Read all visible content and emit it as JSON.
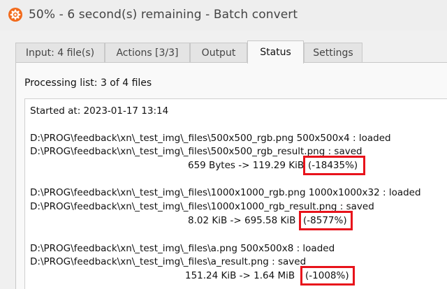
{
  "window": {
    "title": "50% - 6 second(s) remaining - Batch convert",
    "icon": "xnconvert-logo-icon"
  },
  "tabs": [
    {
      "label": "Input: 4 file(s)"
    },
    {
      "label": "Actions [3/3]"
    },
    {
      "label": "Output"
    },
    {
      "label": "Status",
      "active": true
    },
    {
      "label": "Settings"
    }
  ],
  "status": {
    "processing_label": "Processing list:  3 of 4 files",
    "started": "Started at: 2023-01-17 13:14",
    "entries": [
      {
        "loaded": "D:\\PROG\\feedback\\xn\\_test_img\\_files\\500x500_rgb.png 500x500x4 : loaded",
        "saved": "D:\\PROG\\feedback\\xn\\_test_img\\_files\\500x500_rgb_result.png : saved",
        "size": "659 Bytes -> 119.29 KiB",
        "percent": "(-18435%)"
      },
      {
        "loaded": "D:\\PROG\\feedback\\xn\\_test_img\\_files\\1000x1000_rgb.png 1000x1000x32 : loaded",
        "saved": "D:\\PROG\\feedback\\xn\\_test_img\\_files\\1000x1000_rgb_result.png : saved",
        "size": "8.02 KiB -> 695.58 KiB",
        "percent": "(-8577%)"
      },
      {
        "loaded": "D:\\PROG\\feedback\\xn\\_test_img\\_files\\a.png 500x500x8 : loaded",
        "saved": "D:\\PROG\\feedback\\xn\\_test_img\\_files\\a_result.png : saved",
        "size": "151.24 KiB -> 1.64 MiB",
        "percent": "(-1008%)"
      }
    ]
  },
  "colors": {
    "highlight": "#e8131b",
    "icon_orange": "#f26a1b"
  }
}
